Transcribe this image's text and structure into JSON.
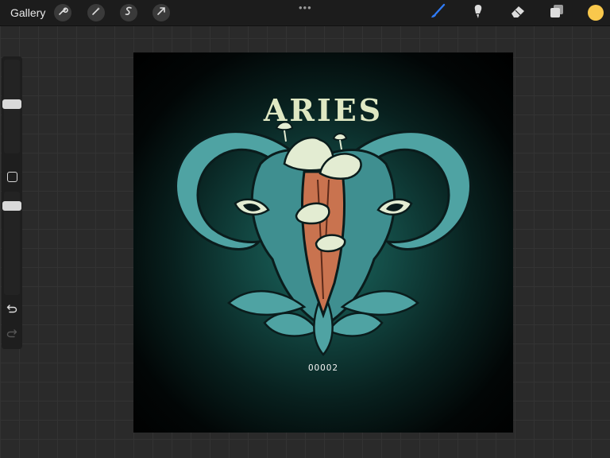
{
  "topbar": {
    "gallery_label": "Gallery",
    "left_tools": [
      "wrench-icon",
      "magic-wand-icon",
      "selection-s-icon",
      "transform-arrow-icon"
    ],
    "more_dots": "•••",
    "right_tools": [
      "brush-icon",
      "smudge-icon",
      "eraser-icon",
      "layers-icon"
    ],
    "active_tool": "brush-icon",
    "current_color": "#f9c84c"
  },
  "sidebar": {
    "brush_size_level": 0.5,
    "opacity_level": 0.7
  },
  "artwork": {
    "title": "ARIES",
    "number": "OOOO2",
    "colors": {
      "teal": "#4fa3a3",
      "teal_dark": "#2c6f72",
      "cream": "#e3ecd2",
      "orange": "#c9734f",
      "background_center": "#1c6a62"
    }
  }
}
